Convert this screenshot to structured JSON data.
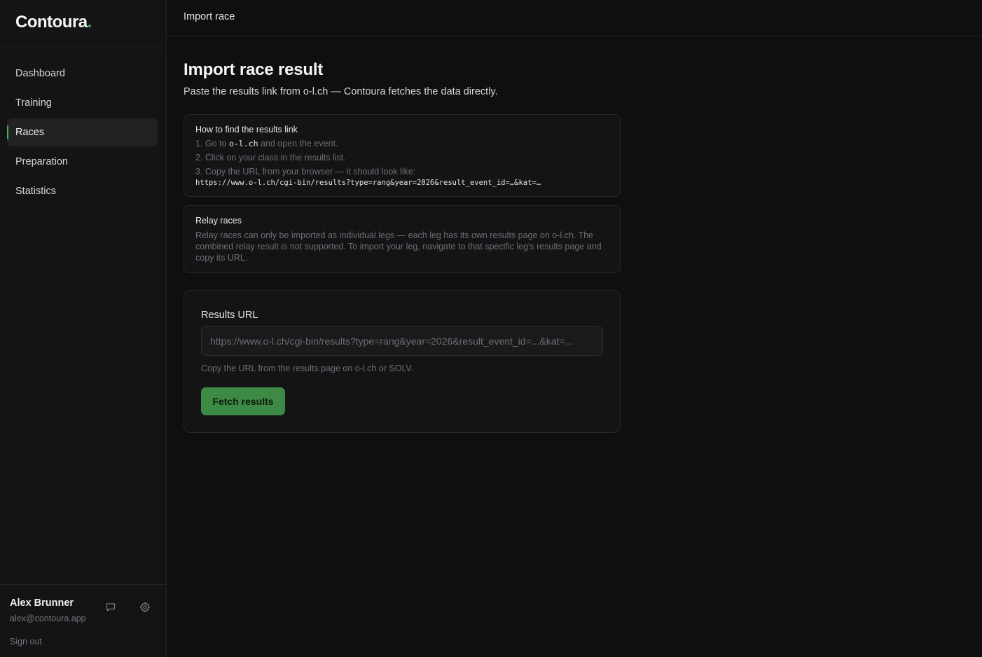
{
  "brand": {
    "name": "Contoura",
    "dot": "."
  },
  "sidebar": {
    "items": [
      {
        "label": "Dashboard"
      },
      {
        "label": "Training"
      },
      {
        "label": "Races"
      },
      {
        "label": "Preparation"
      },
      {
        "label": "Statistics"
      }
    ],
    "active_index": 2
  },
  "user": {
    "name": "Alex Brunner",
    "email": "alex@contoura.app",
    "signout_label": "Sign out",
    "icons": [
      "chat-icon",
      "gear-icon"
    ]
  },
  "topbar": {
    "title": "Import race"
  },
  "page": {
    "title": "Import race result",
    "subtitle": "Paste the results link from o-l.ch — Contoura fetches the data directly."
  },
  "how_to": {
    "title": "How to find the results link",
    "step1_prefix": "1. Go to ",
    "step1_code": "o-l.ch",
    "step1_suffix": " and open the event.",
    "step2": "2. Click on your class in the results list.",
    "step3": "3. Copy the URL from your browser — it should look like:",
    "example_url": "https://www.o-l.ch/cgi-bin/results?type=rang&year=2026&result_event_id=…&kat=…"
  },
  "relay": {
    "title": "Relay races",
    "text": "Relay races can only be imported as individual legs — each leg has its own results page on o-l.ch. The combined relay result is not supported. To import your leg, navigate to that specific leg's results page and copy its URL."
  },
  "form": {
    "label": "Results URL",
    "value": "",
    "placeholder": "https://www.o-l.ch/cgi-bin/results?type=rang&year=2026&result_event_id=...&kat=...",
    "hint": "Copy the URL from the results page on o-l.ch or SOLV.",
    "button_label": "Fetch results"
  },
  "colors": {
    "accent": "#4caf50",
    "button": "#3c8a43",
    "background": "#0f0f10",
    "sidebar": "#141416"
  }
}
